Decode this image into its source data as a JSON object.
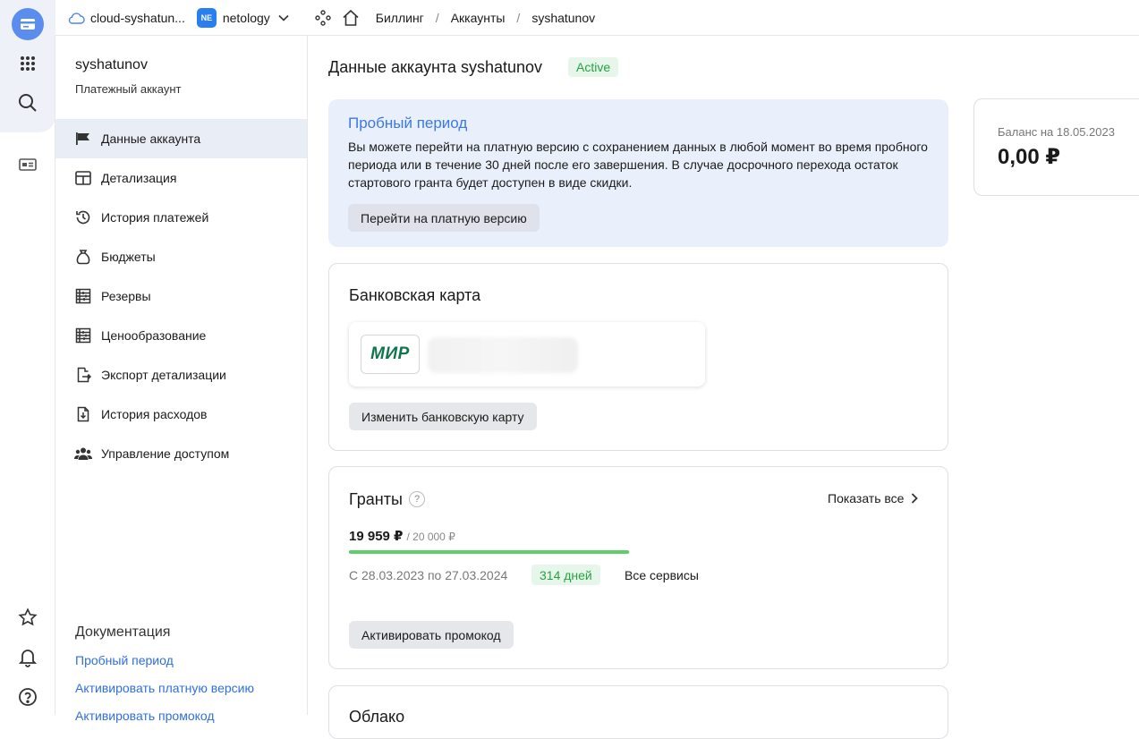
{
  "topbar": {
    "cloud_name": "cloud-syshatun...",
    "org_badge": "NE",
    "org_name": "netology",
    "breadcrumb": [
      "Биллинг",
      "Аккаунты",
      "syshatunov"
    ],
    "separator": "/"
  },
  "sidebar": {
    "account_name": "syshatunov",
    "account_type": "Платежный аккаунт",
    "items": [
      {
        "label": "Данные аккаунта",
        "icon": "flag-icon",
        "active": true
      },
      {
        "label": "Детализация",
        "icon": "table-icon"
      },
      {
        "label": "История платежей",
        "icon": "history-icon"
      },
      {
        "label": "Бюджеты",
        "icon": "money-bag-icon"
      },
      {
        "label": "Резервы",
        "icon": "abacus-icon"
      },
      {
        "label": "Ценообразование",
        "icon": "abacus-icon"
      },
      {
        "label": "Экспорт детализации",
        "icon": "export-icon"
      },
      {
        "label": "История расходов",
        "icon": "download-file-icon"
      },
      {
        "label": "Управление доступом",
        "icon": "users-icon"
      }
    ],
    "docs": {
      "title": "Документация",
      "links": [
        "Пробный период",
        "Активировать платную версию",
        "Активировать промокод"
      ]
    }
  },
  "main": {
    "title": "Данные аккаунта syshatunov",
    "status": "Active",
    "trial": {
      "title": "Пробный период",
      "text": "Вы можете перейти на платную версию с сохранением данных в любой момент во время пробного периода или в течение 30 дней после его завершения. В случае досрочного перехода остаток стартового гранта будет доступен в виде скидки.",
      "button": "Перейти на платную версию"
    },
    "bank_card": {
      "title": "Банковская карта",
      "brand": "МИР",
      "button": "Изменить банковскую карту"
    },
    "grants": {
      "title": "Гранты",
      "help": "?",
      "show_all": "Показать все",
      "amount": "19 959 ₽",
      "total": "/ 20 000 ₽",
      "progress_fraction": 0.998,
      "period": "С 28.03.2023 по 27.03.2024",
      "days": "314 дней",
      "services": "Все сервисы",
      "button": "Активировать промокод"
    },
    "next_card_title": "Облако",
    "balance": {
      "label": "Баланс на 18.05.2023",
      "value": "0,00 ₽"
    }
  },
  "colors": {
    "accent": "#3b78e7",
    "link": "#2f6fe0",
    "success": "#26a243",
    "success_bg": "#e7f6ea",
    "trial_bg": "#eaf0fb",
    "progress": "#5fcf6a"
  }
}
